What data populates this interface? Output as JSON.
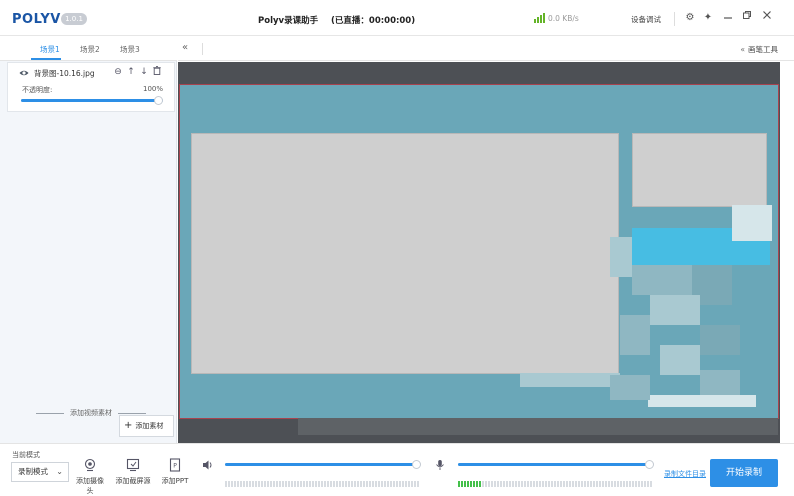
{
  "titlebar": {
    "logo": "POLYV",
    "version": "1.0.1",
    "title": "Polyv录课助手",
    "live_status": "(已直播：00:00:00)",
    "network_speed": "0.0 KB/s",
    "device_debug": "设备调试",
    "icons": [
      "settings-icon",
      "pin-icon",
      "minimize-icon",
      "restore-icon",
      "close-icon"
    ]
  },
  "scenes": {
    "tabs": [
      "场景1",
      "场景2",
      "场景3"
    ],
    "active_index": 0
  },
  "source": {
    "name": "背景图-10.16.jpg",
    "opacity_label": "不透明度:",
    "opacity_value": "100%",
    "opacity_fraction": 1.0
  },
  "left_footer": {
    "add_video_material": "添加视频素材",
    "add_material": "添加素材"
  },
  "right_toolbar": {
    "brush_tool": "画笔工具"
  },
  "bottom": {
    "mode_label": "当前模式",
    "mode_value": "录制模式",
    "add_camera": "添加摄像头",
    "add_screen": "添加截屏源",
    "add_ppt": "添加PPT",
    "speaker_volume_fraction": 0.98,
    "mic_volume_fraction": 0.98,
    "mic_meter_active_segments": 8,
    "record_dir": "录制文件目录",
    "start_record": "开始录制"
  },
  "colors": {
    "accent": "#2d8fe6",
    "logo": "#1a55a5",
    "meter_on": "#44c04a",
    "stage_bg": "#6aa7b8"
  }
}
